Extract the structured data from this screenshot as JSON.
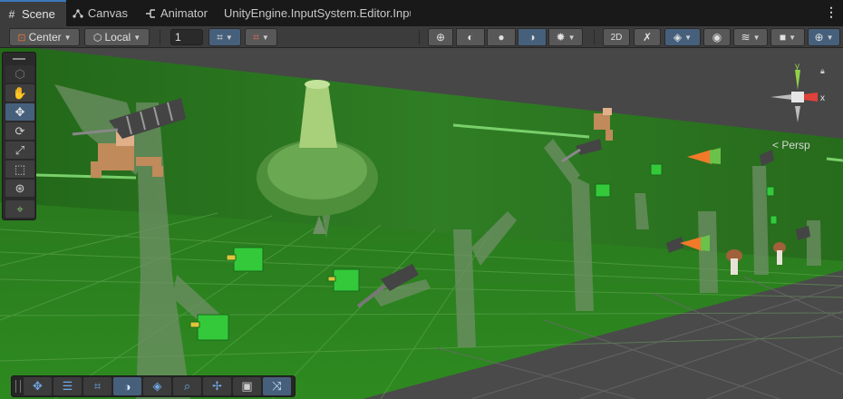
{
  "tabs": [
    {
      "label": "Scene",
      "icon": "grid-icon",
      "active": true
    },
    {
      "label": "Canvas",
      "icon": "nodes-icon",
      "active": false
    },
    {
      "label": "Animator",
      "icon": "animator-icon",
      "active": false
    },
    {
      "label": "UnityEngine.InputSystem.Editor.Inpu",
      "icon": "",
      "active": false
    }
  ],
  "toolbar": {
    "pivot_label": "Center",
    "space_label": "Local",
    "grid_snap_value": "1",
    "persp_label": "Persp"
  },
  "palette": {
    "tools": [
      "view-tool",
      "hand-tool",
      "move-tool",
      "rotate-tool",
      "scale-tool",
      "rect-tool",
      "transform-tool",
      "custom-tool"
    ]
  },
  "bottom_overlay": {
    "tools": [
      "move-overlay",
      "align-overlay",
      "grid-overlay",
      "shading-overlay",
      "layers-overlay",
      "search-overlay",
      "pivot-overlay",
      "camera-overlay",
      "shuffle-overlay"
    ]
  },
  "gizmo": {
    "axis_x": "x",
    "axis_y": "y"
  },
  "colors": {
    "accent": "#46607c",
    "active_tab_border": "#3a79bb",
    "x_axis": "#e0413a",
    "y_axis": "#8fd24a",
    "scene_green": "#2e7a1e"
  }
}
